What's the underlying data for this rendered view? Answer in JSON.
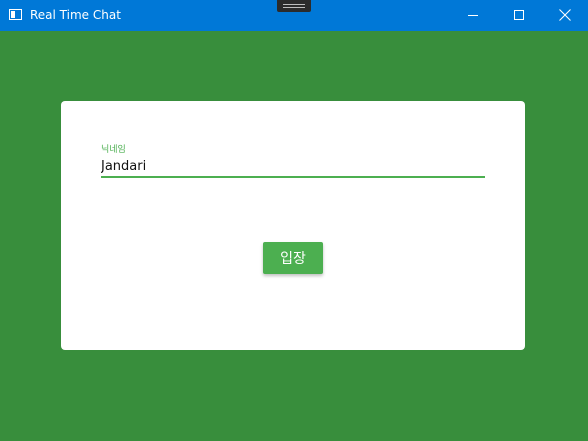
{
  "window": {
    "title": "Real Time Chat",
    "background_color": "#388E3C",
    "titlebar_color": "#0078D7",
    "controls": {
      "minimize_icon": "minimize-icon",
      "maximize_icon": "maximize-icon",
      "close_icon": "close-icon"
    }
  },
  "login_card": {
    "nickname_label": "닉네임",
    "nickname_value": "Jandari",
    "enter_button_label": "입장",
    "accent_color": "#4CAF50"
  }
}
